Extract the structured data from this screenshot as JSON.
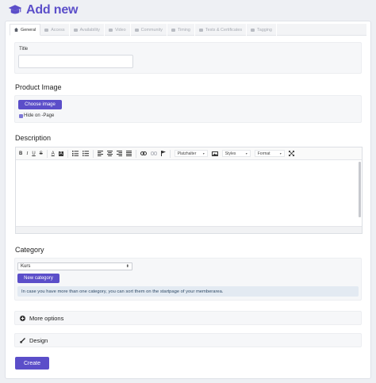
{
  "page": {
    "title": "Add new"
  },
  "tabs": [
    {
      "label": "General",
      "icon": "home-icon",
      "active": true
    },
    {
      "label": "Access",
      "icon": "share-icon",
      "active": false
    },
    {
      "label": "Availability",
      "icon": "calendar-check-icon",
      "active": false
    },
    {
      "label": "Video",
      "icon": "video-icon",
      "active": false
    },
    {
      "label": "Community",
      "icon": "users-icon",
      "active": false
    },
    {
      "label": "Timing",
      "icon": "clock-icon",
      "active": false
    },
    {
      "label": "Tests & Certificates",
      "icon": "trophy-icon",
      "active": false
    },
    {
      "label": "Tagging",
      "icon": "tag-icon",
      "active": false
    }
  ],
  "title_field": {
    "label": "Title",
    "value": ""
  },
  "product_image": {
    "heading": "Product Image",
    "choose_label": "Choose image",
    "hide_label": "Hide on -Page",
    "hide_checked": true
  },
  "description": {
    "heading": "Description",
    "toolbar": {
      "bold": "B",
      "italic": "I",
      "underline": "U",
      "strike": "S",
      "font_color": "A",
      "bg_color": "A",
      "placeholder_select": "Platzhalter",
      "styles_select": "Styles",
      "format_select": "Format"
    }
  },
  "category": {
    "heading": "Category",
    "selected": "Kurs",
    "new_label": "New category",
    "info": "In case you have more than one category, you can sort them on the startpage of your memberarea."
  },
  "more_options": {
    "label": "More options"
  },
  "design": {
    "label": "Design"
  },
  "create": {
    "label": "Create"
  },
  "colors": {
    "accent": "#5b4ec9",
    "info_bg": "#e3eaf2",
    "panel_bg": "#f6f7f9"
  }
}
